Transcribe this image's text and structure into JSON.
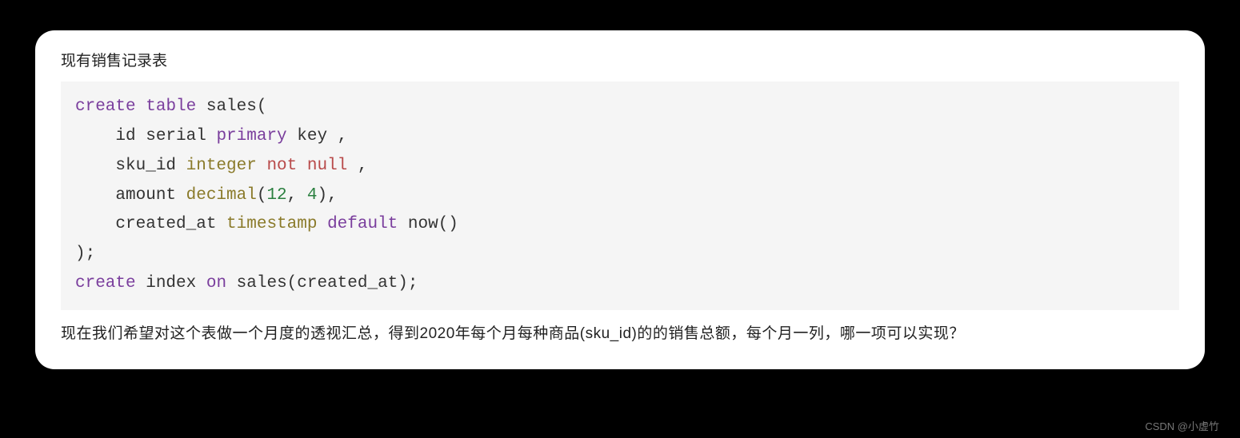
{
  "intro": "现有销售记录表",
  "code": {
    "tokens": [
      {
        "t": "create",
        "c": "kw-purple"
      },
      {
        "t": " "
      },
      {
        "t": "table",
        "c": "kw-purple"
      },
      {
        "t": " sales(\n"
      },
      {
        "t": "    id serial "
      },
      {
        "t": "primary",
        "c": "kw-purple"
      },
      {
        "t": " key ,\n"
      },
      {
        "t": "    sku_id "
      },
      {
        "t": "integer",
        "c": "kw-olive"
      },
      {
        "t": " "
      },
      {
        "t": "not",
        "c": "kw-red"
      },
      {
        "t": " "
      },
      {
        "t": "null",
        "c": "kw-red"
      },
      {
        "t": " ,\n"
      },
      {
        "t": "    amount "
      },
      {
        "t": "decimal",
        "c": "kw-olive"
      },
      {
        "t": "("
      },
      {
        "t": "12",
        "c": "num"
      },
      {
        "t": ", "
      },
      {
        "t": "4",
        "c": "num"
      },
      {
        "t": "),\n"
      },
      {
        "t": "    created_at "
      },
      {
        "t": "timestamp",
        "c": "kw-olive"
      },
      {
        "t": " "
      },
      {
        "t": "default",
        "c": "kw-purple"
      },
      {
        "t": " now()\n"
      },
      {
        "t": ");\n"
      },
      {
        "t": "create",
        "c": "kw-purple"
      },
      {
        "t": " index "
      },
      {
        "t": "on",
        "c": "kw-purple"
      },
      {
        "t": " sales(created_at);"
      }
    ]
  },
  "outro": "现在我们希望对这个表做一个月度的透视汇总，得到2020年每个月每种商品(sku_id)的的销售总额，每个月一列，哪一项可以实现？",
  "attribution": "CSDN @小虚竹"
}
